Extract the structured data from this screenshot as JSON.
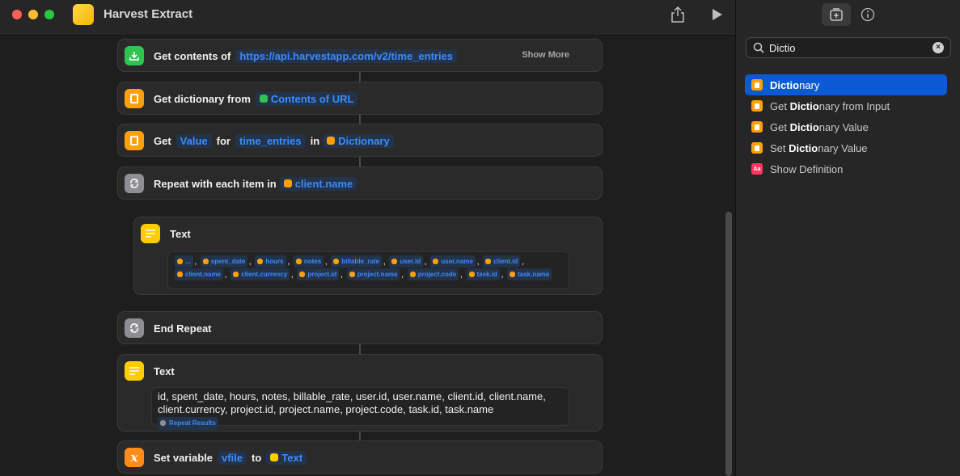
{
  "window": {
    "title": "Harvest Extract",
    "colors": {
      "close": "#ff5f57",
      "minimize": "#febc2e",
      "zoom": "#28c840",
      "accent": "#0a5bd3",
      "token": "#3b8cff"
    }
  },
  "actions": {
    "get_contents": {
      "label": "Get contents of",
      "url": "https://api.harvestapp.com/v2/time_entries",
      "show_more": "Show More",
      "icon": "download-icon"
    },
    "get_dictionary": {
      "label": "Get dictionary from",
      "input": "Contents of URL",
      "icon": "dictionary-icon"
    },
    "get_value": {
      "label_get": "Get",
      "key_type": "Value",
      "label_for": "for",
      "key": "time_entries",
      "label_in": "in",
      "source": "Dictionary",
      "icon": "dictionary-icon"
    },
    "repeat": {
      "label": "Repeat with each item in",
      "input": "client.name",
      "icon": "repeat-icon"
    },
    "inner_text": {
      "label": "Text",
      "icon": "text-icon",
      "chips": [
        "...",
        "spent_date",
        "hours",
        "notes",
        "billable_rate",
        "user.id",
        "user.name",
        "client.id",
        "client.name",
        "client.currency",
        "project.id",
        "project.name",
        "project.code",
        "task.id",
        "task.name"
      ]
    },
    "end_repeat": {
      "label": "End Repeat",
      "icon": "repeat-icon"
    },
    "outer_text": {
      "label": "Text",
      "icon": "text-icon",
      "line1": "id, spent_date, hours, notes, billable_rate, user.id, user.name, client.id, client.name,",
      "line2": "client.currency, project.id, project.name, project.code, task.id, task.name",
      "variable": "Repeat Results"
    },
    "set_variable": {
      "label": "Set variable",
      "name": "vfile",
      "label_to": "to",
      "value": "Text",
      "icon": "variable-icon"
    }
  },
  "sidebar": {
    "search": {
      "value": "Dictio",
      "placeholder": "Search"
    },
    "results": [
      {
        "match": "Dictio",
        "rest": "nary",
        "prefix": "",
        "icon": "dictionary-icon",
        "selected": true
      },
      {
        "prefix": "Get ",
        "match": "Dictio",
        "rest": "nary from Input",
        "icon": "dictionary-icon",
        "selected": false
      },
      {
        "prefix": "Get ",
        "match": "Dictio",
        "rest": "nary Value",
        "icon": "dictionary-icon",
        "selected": false
      },
      {
        "prefix": "Set ",
        "match": "Dictio",
        "rest": "nary Value",
        "icon": "dictionary-icon",
        "selected": false
      },
      {
        "prefix": "",
        "match": "",
        "rest": "Show Definition",
        "icon": "dictionary-definition-icon",
        "selected": false
      }
    ]
  }
}
